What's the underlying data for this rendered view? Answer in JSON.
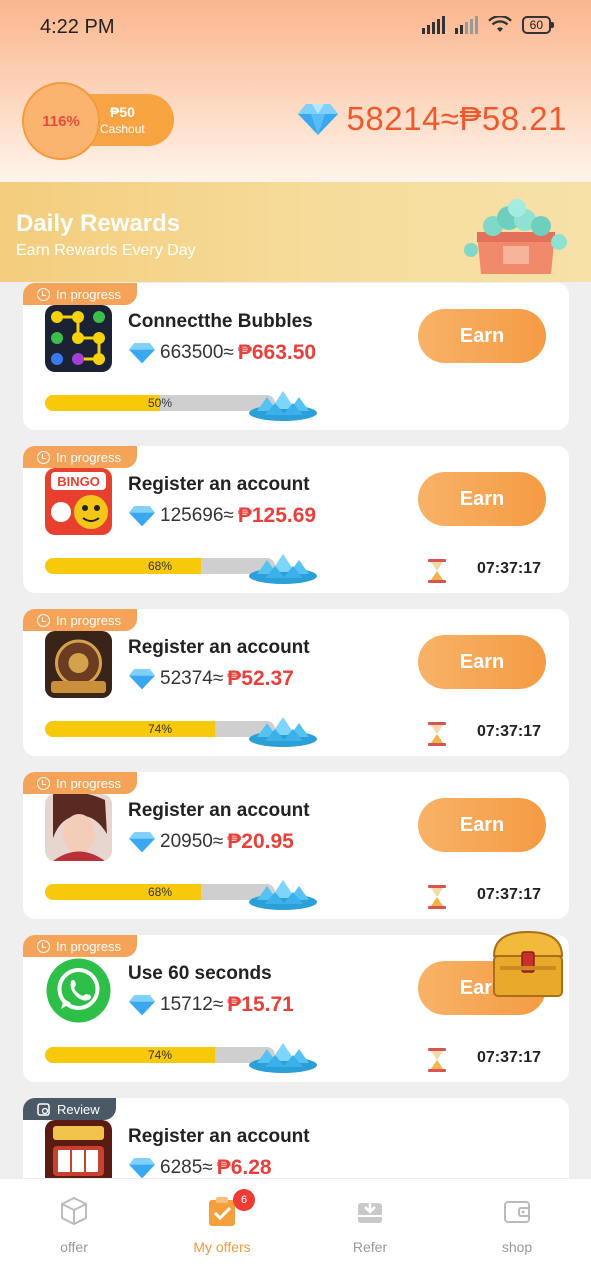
{
  "status_bar": {
    "time": "4:22 PM",
    "battery": "60"
  },
  "header": {
    "progress_percent": "116%",
    "cashout_amount": "₱50",
    "cashout_label": "Cashout",
    "balance": "58214≈₱58.21"
  },
  "banner": {
    "title": "Daily Rewards",
    "subtitle": "Earn Rewards Every Day"
  },
  "tasks": [
    {
      "tag": "In progress",
      "title": "Connectthe Bubbles",
      "diamonds": "663500≈",
      "peso": "₱663.50",
      "progress": "50%",
      "progress_value": 50,
      "button": "Earn",
      "timer": "",
      "icon": "bubbles-game-icon"
    },
    {
      "tag": "In progress",
      "title": "Register an account",
      "diamonds": "125696≈",
      "peso": "₱125.69",
      "progress": "68%",
      "progress_value": 68,
      "button": "Earn",
      "timer": "07:37:17",
      "icon": "bingo-plus-icon"
    },
    {
      "tag": "In progress",
      "title": "Register an account",
      "diamonds": "52374≈",
      "peso": "₱52.37",
      "progress": "74%",
      "progress_value": 74,
      "button": "Earn",
      "timer": "07:37:17",
      "icon": "roulette-royale-icon"
    },
    {
      "tag": "In progress",
      "title": "Register an account",
      "diamonds": "20950≈",
      "peso": "₱20.95",
      "progress": "68%",
      "progress_value": 68,
      "button": "Earn",
      "timer": "07:37:17",
      "icon": "hero-game-icon"
    },
    {
      "tag": "In progress",
      "title": "Use 60 seconds",
      "diamonds": "15712≈",
      "peso": "₱15.71",
      "progress": "74%",
      "progress_value": 74,
      "button": "Earn",
      "timer": "07:37:17",
      "icon": "whatsapp-icon"
    },
    {
      "tag": "Review",
      "title": "Register an account",
      "diamonds": "6285≈",
      "peso": "₱6.28",
      "progress": "",
      "progress_value": 0,
      "button": "",
      "timer": "",
      "icon": "lucky-slots-icon"
    }
  ],
  "bottom_nav": [
    {
      "label": "offer",
      "icon": "cube-icon"
    },
    {
      "label": "My offers",
      "icon": "clipboard-check-icon",
      "badge": "6",
      "active": true
    },
    {
      "label": "Refer",
      "icon": "inbox-download-icon"
    },
    {
      "label": "shop",
      "icon": "wallet-icon"
    }
  ],
  "colors": {
    "accent": "#f59a3a",
    "price_red": "#e8403a",
    "progress_yellow": "#f7c90a",
    "balance": "#ef5a2d"
  }
}
